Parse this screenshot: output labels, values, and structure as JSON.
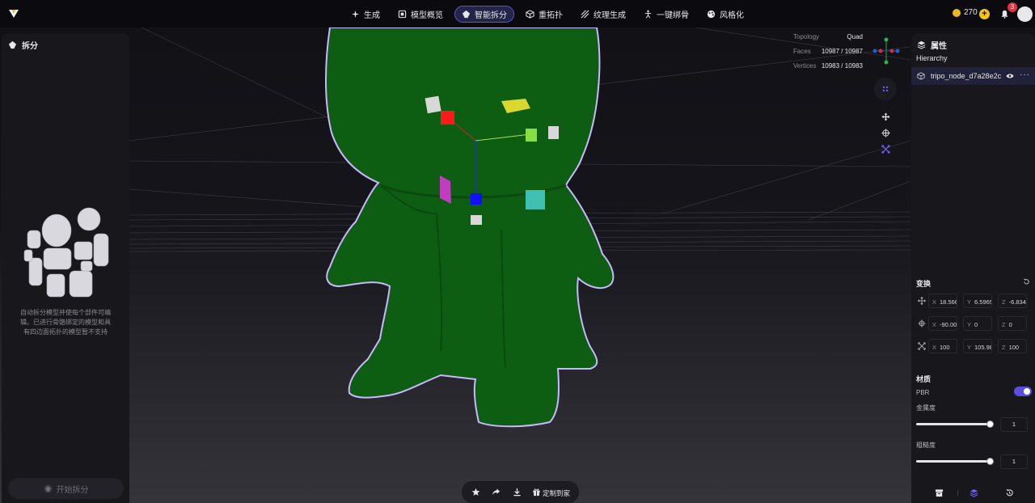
{
  "nav": {
    "items": [
      {
        "label": "生成",
        "icon": "sparkle-icon"
      },
      {
        "label": "模型概览",
        "icon": "overview-icon"
      },
      {
        "label": "智能拆分",
        "icon": "split-icon",
        "active": true
      },
      {
        "label": "重拓扑",
        "icon": "retopo-icon"
      },
      {
        "label": "纹理生成",
        "icon": "texture-icon"
      },
      {
        "label": "一键绑骨",
        "icon": "rig-icon"
      },
      {
        "label": "风格化",
        "icon": "style-icon"
      }
    ],
    "credits": "270",
    "notification_count": "3"
  },
  "left_panel": {
    "title": "拆分",
    "description": "自动拆分模型并使每个部件可编辑。已进行骨骼绑定的模型和具有四边面拓扑的模型暂不支持",
    "start_button": "开始拆分"
  },
  "stats": {
    "topology_label": "Topology",
    "topology_value": "Quad",
    "faces_label": "Faces",
    "faces_value": "10987 / 10987",
    "vertices_label": "Vertices",
    "vertices_value": "10983 / 10983"
  },
  "right_panel": {
    "title": "属性",
    "hierarchy_label": "Hierarchy",
    "node_name": "tripo_node_d7a28e2c",
    "more": "···",
    "transform_title": "变换",
    "position": {
      "x": "18.566",
      "y": "6.5965",
      "z": "-6.834"
    },
    "rotation": {
      "x": "-90.00",
      "y": "0",
      "z": "0"
    },
    "scale": {
      "x": "100",
      "y": "105.98",
      "z": "100"
    },
    "axis_x": "X",
    "axis_y": "Y",
    "axis_z": "Z",
    "material_title": "材质",
    "pbr_label": "PBR",
    "pbr_enabled": true,
    "metalness_label": "金属度",
    "metalness_value": "1",
    "roughness_label": "粗糙度",
    "roughness_value": "1"
  },
  "bottom_bar": {
    "customize_label": "定制到家"
  },
  "colors": {
    "accent": "#5a4ee0",
    "model_green": "#0d5e12",
    "outline": "#c9b8ff"
  }
}
